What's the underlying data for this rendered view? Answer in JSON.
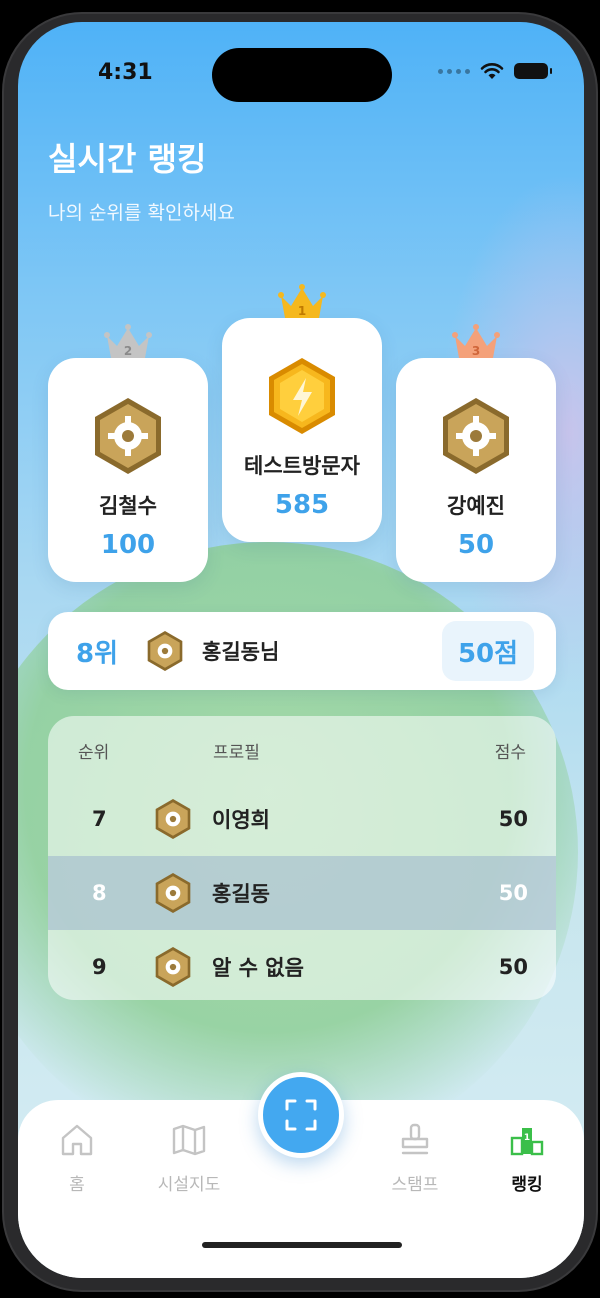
{
  "status_bar": {
    "time": "4:31"
  },
  "header": {
    "title": "실시간 랭킹",
    "subtitle": "나의 순위를 확인하세요"
  },
  "podium": [
    {
      "place": "1",
      "name": "테스트방문자",
      "score": "585"
    },
    {
      "place": "2",
      "name": "김철수",
      "score": "100"
    },
    {
      "place": "3",
      "name": "강예진",
      "score": "50"
    }
  ],
  "my_rank": {
    "rank": "8위",
    "name": "홍길동님",
    "score": "50점"
  },
  "table": {
    "headers": {
      "rank": "순위",
      "profile": "프로필",
      "score": "점수"
    },
    "rows": [
      {
        "rank": "7",
        "name": "이영희",
        "score": "50",
        "highlighted": false
      },
      {
        "rank": "8",
        "name": "홍길동",
        "score": "50",
        "highlighted": true
      },
      {
        "rank": "9",
        "name": "알 수 없음",
        "score": "50",
        "highlighted": false
      }
    ]
  },
  "tabbar": {
    "items": [
      {
        "label": "홈",
        "icon": "home-icon",
        "active": false
      },
      {
        "label": "시설지도",
        "icon": "map-icon",
        "active": false
      },
      {
        "label": "",
        "icon": "scan-icon",
        "active": false
      },
      {
        "label": "스탬프",
        "icon": "stamp-icon",
        "active": false
      },
      {
        "label": "랭킹",
        "icon": "ranking-icon",
        "active": true
      }
    ]
  },
  "colors": {
    "accent": "#3ea2ea",
    "active_tab": "#3bbf4a",
    "gold": "#f5b81e",
    "silver": "#b7b7b7",
    "bronze": "#f09a6e"
  }
}
